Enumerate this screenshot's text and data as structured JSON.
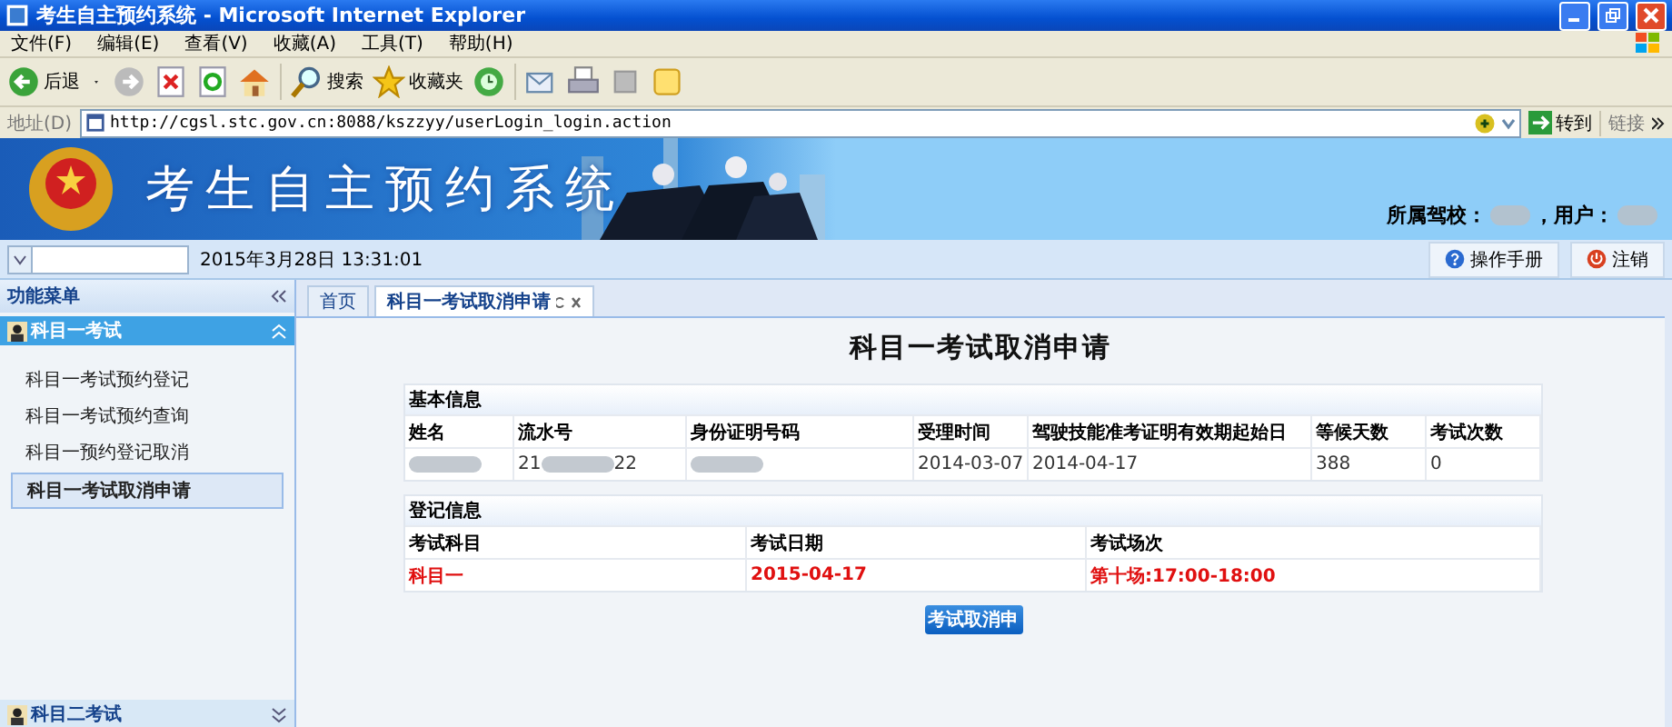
{
  "window": {
    "title": "考生自主预约系统 - Microsoft Internet Explorer"
  },
  "menu": [
    "文件(F)",
    "编辑(E)",
    "查看(V)",
    "收藏(A)",
    "工具(T)",
    "帮助(H)"
  ],
  "toolbar": {
    "back": "后退",
    "search": "搜索",
    "favorites": "收藏夹"
  },
  "address": {
    "label": "地址(D)",
    "url": "http://cgsl.stc.gov.cn:8088/kszzyy/userLogin_login.action",
    "go": "转到",
    "links": "链接"
  },
  "banner": {
    "title": "考生自主预约系统",
    "school_label": "所属驾校：",
    "user_label": "，用户："
  },
  "datebar": {
    "datetime": "2015年3月28日 13:31:01",
    "buttons": [
      {
        "kind": "help",
        "label": "操作手册"
      },
      {
        "kind": "logout",
        "label": "注销"
      }
    ]
  },
  "sidebar": {
    "title": "功能菜单",
    "groups": [
      {
        "label": "科目一考试",
        "expanded": true,
        "items": [
          {
            "label": "科目一考试预约登记",
            "selected": false
          },
          {
            "label": "科目一考试预约查询",
            "selected": false
          },
          {
            "label": "科目一预约登记取消",
            "selected": false
          },
          {
            "label": "科目一考试取消申请",
            "selected": true
          }
        ]
      },
      {
        "label": "科目二考试",
        "expanded": false
      }
    ]
  },
  "tabs": [
    {
      "label": "首页",
      "selected": false,
      "closable": false
    },
    {
      "label": "科目一考试取消申请",
      "selected": true,
      "closable": true
    }
  ],
  "form": {
    "title": "科目一考试取消申请",
    "sections": [
      {
        "title": "基本信息",
        "columns": [
          "姓名",
          "流水号",
          "身份证明号码",
          "受理时间",
          "驾驶技能准考证明有效期起始日",
          "等候天数",
          "考试次数"
        ],
        "row": [
          {
            "kind": "blurred"
          },
          {
            "kind": "partly_blurred",
            "before": "21",
            "after": "22"
          },
          {
            "kind": "blurred"
          },
          {
            "kind": "text",
            "text": "2014-03-07"
          },
          {
            "kind": "text",
            "text": "2014-04-17"
          },
          {
            "kind": "text",
            "text": "388"
          },
          {
            "kind": "text",
            "text": "0"
          }
        ]
      },
      {
        "title": "登记信息",
        "columns": [
          "考试科目",
          "考试日期",
          "考试场次"
        ],
        "row": [
          {
            "kind": "emphasis",
            "text": "科目一"
          },
          {
            "kind": "emphasis",
            "text": "2015-04-17"
          },
          {
            "kind": "emphasis",
            "text": "第十场:17:00-18:00"
          }
        ]
      }
    ],
    "submit": "考试取消申"
  }
}
